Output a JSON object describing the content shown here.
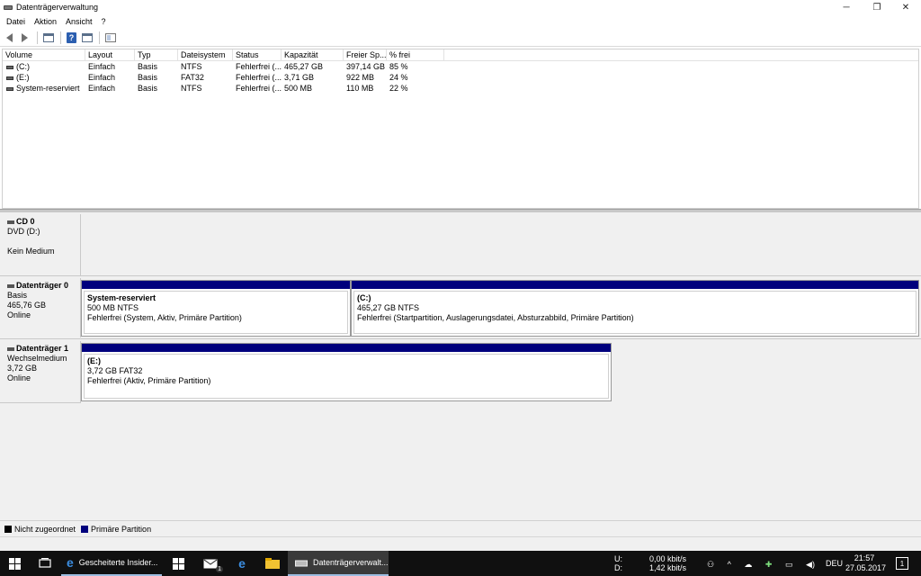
{
  "window": {
    "title": "Datenträgerverwaltung",
    "controls": {
      "minimize": "─",
      "restore": "❐",
      "close": "✕"
    }
  },
  "menu": [
    "Datei",
    "Aktion",
    "Ansicht",
    "?"
  ],
  "toolbar": {
    "icons": [
      "back-arrow-icon",
      "forward-arrow-icon",
      "console-tree-icon",
      "help-icon",
      "properties-icon",
      "show-hide-icon"
    ],
    "help_glyph": "?"
  },
  "volume_table": {
    "headers": [
      "Volume",
      "Layout",
      "Typ",
      "Dateisystem",
      "Status",
      "Kapazität",
      "Freier Sp...",
      "% frei"
    ],
    "rows": [
      [
        "(C:)",
        "Einfach",
        "Basis",
        "NTFS",
        "Fehlerfrei (...",
        "465,27 GB",
        "397,14 GB",
        "85 %"
      ],
      [
        "(E:)",
        "Einfach",
        "Basis",
        "FAT32",
        "Fehlerfrei (...",
        "3,71 GB",
        "922 MB",
        "24 %"
      ],
      [
        "System-reserviert",
        "Einfach",
        "Basis",
        "NTFS",
        "Fehlerfrei (...",
        "500 MB",
        "110 MB",
        "22 %"
      ]
    ]
  },
  "disks": {
    "cd0": {
      "name": "CD 0",
      "line1": "DVD (D:)",
      "line2": "",
      "line3": "Kein Medium"
    },
    "disk0": {
      "name": "Datenträger 0",
      "line1": "Basis",
      "line2": "465,76 GB",
      "line3": "Online",
      "partitions": [
        {
          "name": "System-reserviert",
          "size": "500 MB NTFS",
          "status": "Fehlerfrei (System, Aktiv, Primäre Partition)"
        },
        {
          "name": "(C:)",
          "size": "465,27 GB NTFS",
          "status": "Fehlerfrei (Startpartition, Auslagerungsdatei, Absturzabbild, Primäre Partition)"
        }
      ]
    },
    "disk1": {
      "name": "Datenträger 1",
      "line1": "Wechselmedium",
      "line2": "3,72 GB",
      "line3": "Online",
      "partitions": [
        {
          "name": "(E:)",
          "size": "3,72 GB FAT32",
          "status": "Fehlerfrei (Aktiv, Primäre Partition)"
        }
      ]
    }
  },
  "legend": [
    {
      "label": "Nicht zugeordnet",
      "color": "#000000"
    },
    {
      "label": "Primäre Partition",
      "color": "#00007d"
    }
  ],
  "taskbar": {
    "items": [
      {
        "label": "",
        "icon": "start-windows-icon"
      },
      {
        "label": "",
        "icon": "task-view-icon"
      },
      {
        "label": "Gescheiterte Insider...",
        "icon": "edge-icon"
      },
      {
        "label": "",
        "icon": "store-icon"
      },
      {
        "label": "1",
        "icon": "mail-icon"
      },
      {
        "label": "",
        "icon": "edge-icon"
      },
      {
        "label": "",
        "icon": "file-explorer-icon"
      },
      {
        "label": "Datenträgerverwalt...",
        "icon": "disk-management-icon"
      }
    ],
    "net_upload_label": "U:",
    "net_download_label": "D:",
    "net_upload": "0,00 kbit/s",
    "net_download": "1,42 kbit/s",
    "language": "DEU",
    "time": "21:57",
    "date": "27.05.2017",
    "notification_count": "1"
  }
}
